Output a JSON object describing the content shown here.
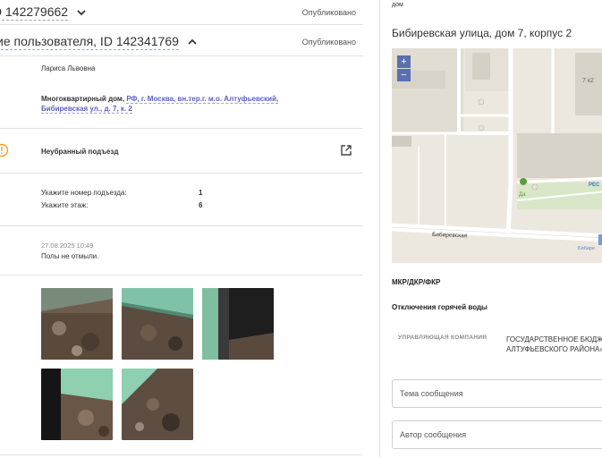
{
  "left": {
    "header1": {
      "title": "D 142279662",
      "status": "Опубликовано"
    },
    "header2": {
      "title": "ие пользователя, ID 142341769",
      "status": "Опубликовано"
    },
    "author_name": "Лариса Львовна",
    "address_prefix": "Многоквартирный дом,",
    "address_line1": "РФ, г. Москва, вн.тер.г. м.о. Алтуфьевский,",
    "address_line2": "Бибиревская ул., д. 7, к. 2",
    "category": "Неубранный подъезд",
    "entrance_label": "Укажите номер подъезда:",
    "entrance_value": "1",
    "floor_label": "Укажите этаж:",
    "floor_value": "6",
    "timestamp": "27.08.2025 10:49",
    "comment": "Полы не отмыли."
  },
  "right": {
    "top_text": "дом",
    "title": "Бибиревская улица, дом 7, корпус 2",
    "map": {
      "zoom_in": "+",
      "zoom_out": "−",
      "house_label": "7 к2",
      "street_label": "Бибиревская",
      "shop_label": "Да",
      "res_label": "РЕС",
      "street_label2": "Бибире"
    },
    "mkd_label": "МКР/ДКР/ФКР",
    "hot_water_label": "Отключения горячей воды",
    "mgmt_caption": "УПРАВЛЯЮЩАЯ КОМПАНИЯ",
    "mgmt_org_line1": "ГОСУДАРСТВЕННОЕ БЮДЖ",
    "mgmt_org_line2": "АЛТУФЬЕВСКОГО РАЙОНА»",
    "subject_placeholder": "Тема сообщения",
    "author_placeholder": "Автор сообщения"
  },
  "colors": {
    "accent": "#5b5fc7",
    "warning": "#f0a020",
    "map_zoom": "#5b6fb0"
  },
  "icons": [
    "chevron-down-icon",
    "chevron-up-icon",
    "warning-icon",
    "external-link-icon"
  ]
}
